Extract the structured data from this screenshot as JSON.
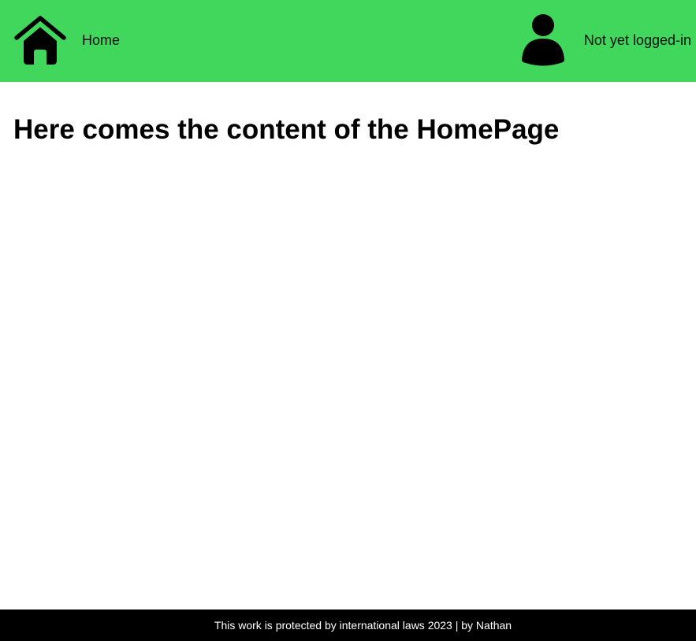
{
  "colors": {
    "header_bg": "#41d75c",
    "footer_bg": "#000000",
    "footer_text": "#ffffff",
    "title_text": "#000000"
  },
  "header": {
    "home": {
      "icon": "home-icon",
      "label": "Home"
    },
    "user": {
      "icon": "user-icon",
      "status": "Not yet logged-in"
    }
  },
  "main": {
    "title": "Here comes the content of the HomePage"
  },
  "footer": {
    "text": "This work is protected by international laws 2023 | by Nathan"
  }
}
